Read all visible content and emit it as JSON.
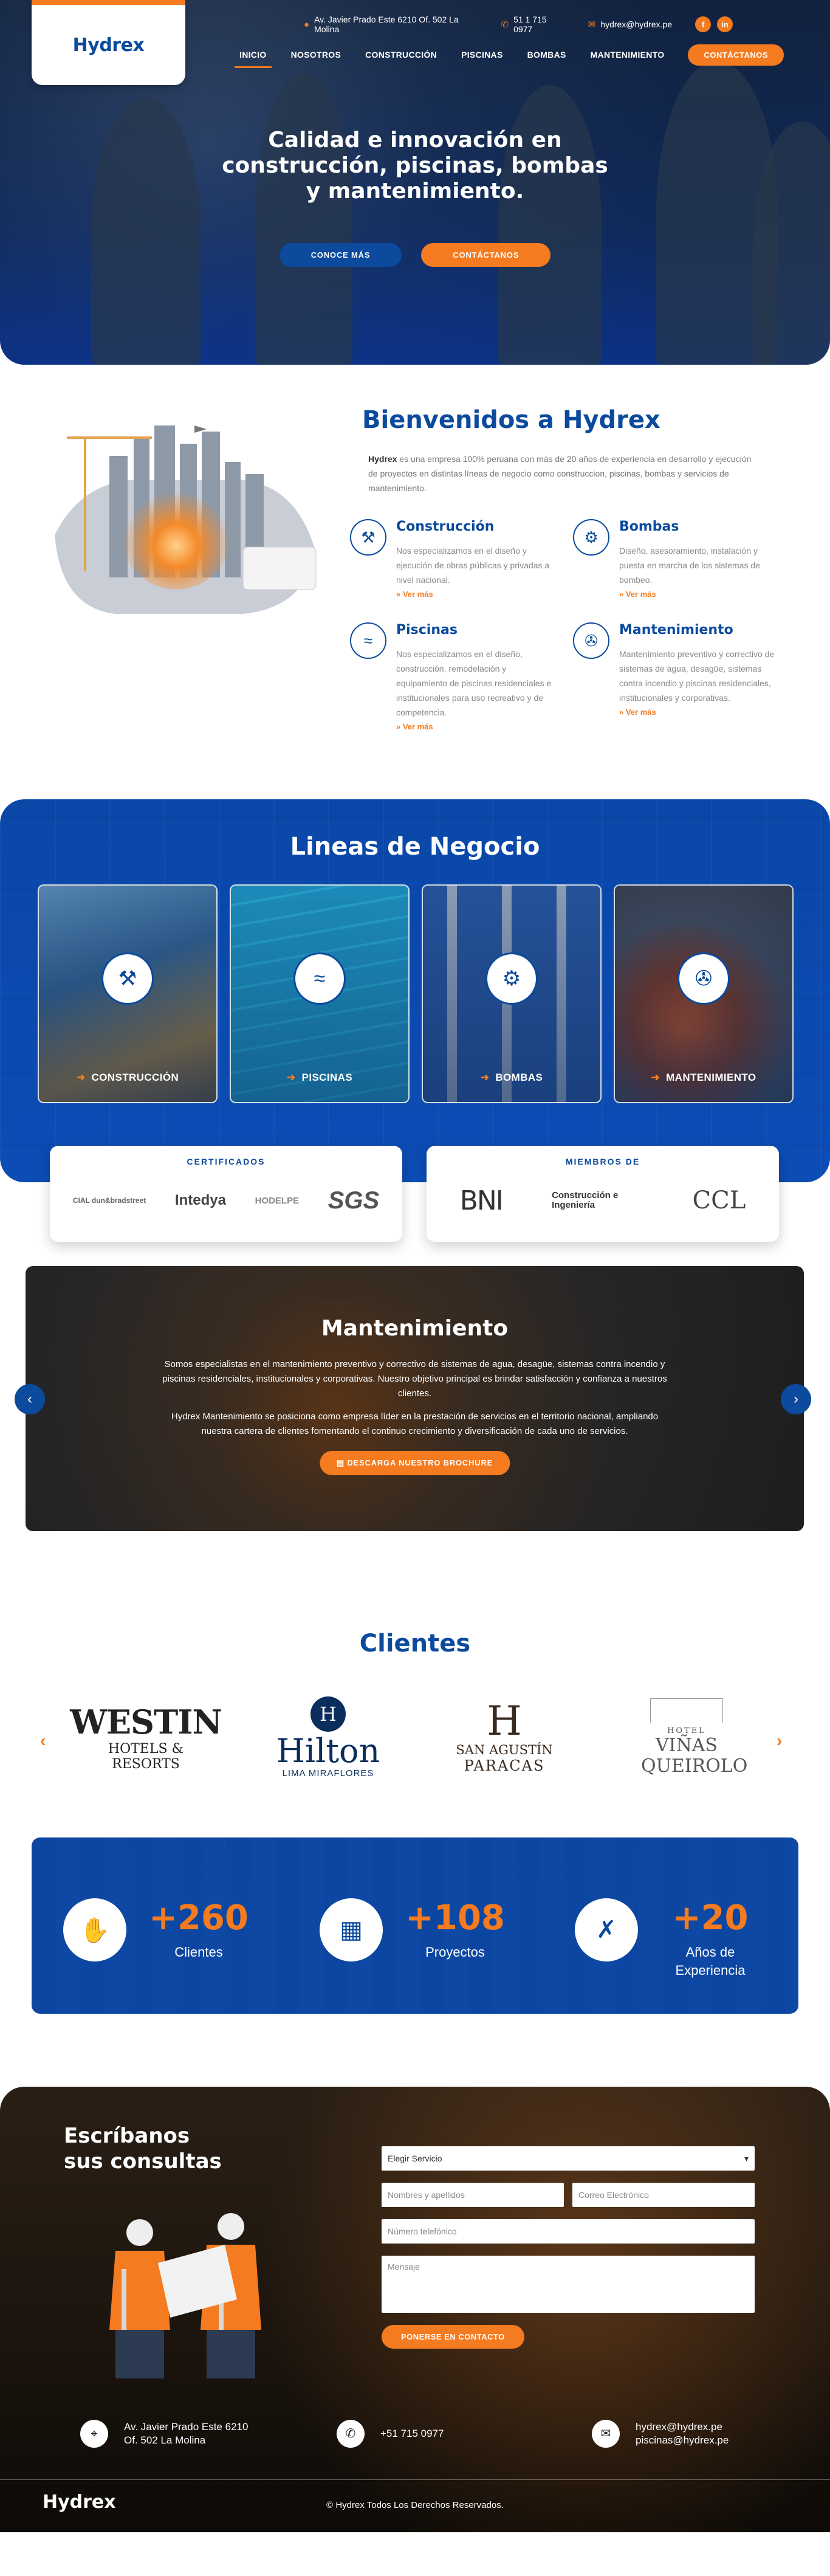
{
  "brand": {
    "logo": "Hydrex",
    "accent": "#f47b20",
    "primary": "#0b4a9c"
  },
  "topbar": {
    "address": "Av. Javier Prado Este 6210 Of. 502 La Molina",
    "phone": "51 1 715 0977",
    "email": "hydrex@hydrex.pe",
    "socials": [
      "f",
      "in"
    ]
  },
  "nav": {
    "items": [
      "INICIO",
      "NOSOTROS",
      "CONSTRUCCIÓN",
      "PISCINAS",
      "BOMBAS",
      "MANTENIMIENTO"
    ],
    "cta": "CONTÁCTANOS"
  },
  "hero": {
    "title": "Calidad e innovación en construcción, piscinas, bombas y mantenimiento.",
    "btn_primary": "CONOCE MÁS",
    "btn_secondary": "CONTÁCTANOS"
  },
  "welcome": {
    "title": "Bienvenidos a Hydrex",
    "brand_word": "Hydrex",
    "desc": " es una empresa 100% peruana con más de 20 años de experiencia en desarrollo y ejecución de proyectos en distintas líneas de negocio como construccion, piscinas, bombas y servicios de mantenimiento.",
    "services": [
      {
        "title": "Construcción",
        "icon": "construction-icon",
        "text": "Nos especializamos en el diseño y ejecución de obras públicas y privadas a nivel nacional.",
        "more": "» Ver más"
      },
      {
        "title": "Bombas",
        "icon": "pump-icon",
        "text": "Diseño, asesoramiento, instalación y puesta en marcha de los sistemas de bombeo.",
        "more": "» Ver más"
      },
      {
        "title": "Piscinas",
        "icon": "pool-icon",
        "text": "Nos especializamos en el diseño, construcción, remodelación y equipamiento de piscinas residenciales e institucionales para uso recreativo y de competencia.",
        "more": "» Ver más"
      },
      {
        "title": "Mantenimiento",
        "icon": "maintenance-icon",
        "text": "Mantenimiento preventivo y correctivo de sistemas de agua, desagüe, sistemas contra incendio y piscinas residenciales, institucionales y corporativas.",
        "more": "» Ver más"
      }
    ]
  },
  "lineas": {
    "title": "Lineas de Negocio",
    "cards": [
      {
        "label": "CONSTRUCCIÓN",
        "icon": "construction-icon"
      },
      {
        "label": "PISCINAS",
        "icon": "pool-icon"
      },
      {
        "label": "BOMBAS",
        "icon": "pump-icon"
      },
      {
        "label": "MANTENIMIENTO",
        "icon": "maintenance-icon"
      }
    ],
    "certificados": {
      "title": "CERTIFICADOS",
      "logos": [
        "CIAL dun&bradstreet",
        "Intedya",
        "HODELPE",
        "SGS"
      ]
    },
    "miembros": {
      "title": "MIEMBROS DE",
      "logos": [
        "BNI",
        "Construcción e Ingeniería",
        "CCL"
      ]
    }
  },
  "slider": {
    "title": "Mantenimiento",
    "p1": "Somos especialistas en el mantenimiento preventivo y correctivo de sistemas de agua, desagüe, sistemas contra incendio y piscinas residenciales, institucionales y corporativas. Nuestro objetivo principal es brindar satisfacción y confianza a nuestros clientes.",
    "p2": "Hydrex Mantenimiento se posiciona como empresa líder en la prestación de servicios en el territorio nacional, ampliando nuestra cartera de clientes fomentando el continuo crecimiento y diversificación de cada uno de servicios.",
    "btn": "DESCARGA NUESTRO BROCHURE",
    "prev": "‹",
    "next": "›"
  },
  "clientes": {
    "title": "Clientes",
    "logos": [
      {
        "l1": "WESTIN",
        "l2": "HOTELS & RESORTS"
      },
      {
        "l1": "Hilton",
        "l2": "LIMA MIRAFLORES"
      },
      {
        "l1": "SAN AGUSTÍN",
        "l2": "PARACAS"
      },
      {
        "l1": "HOTEL",
        "l2": "VIÑAS QUEIROLO"
      }
    ],
    "prev": "‹",
    "next": "›"
  },
  "stats": [
    {
      "num": "+260",
      "label": "Clientes",
      "icon": "handshake-icon"
    },
    {
      "num": "+108",
      "label": "Proyectos",
      "icon": "blueprint-icon"
    },
    {
      "num": "+20",
      "label": "Años de Experiencia",
      "icon": "tools-icon"
    }
  ],
  "contact": {
    "title_l1": "Escríbanos",
    "title_l2": "sus consultas",
    "service_select": "Elegir Servicio",
    "name_ph": "Nombres y apellidos",
    "email_ph": "Correo Electrónico",
    "phone_ph": "Número telefónico",
    "message_ph": "Mensaje",
    "submit": "PONERSE EN CONTACTO",
    "addr_l1": "Av. Javier Prado Este 6210",
    "addr_l2": "Of. 502 La Molina",
    "phone": "+51 715 0977",
    "email1": "hydrex@hydrex.pe",
    "email2": "piscinas@hydrex.pe"
  },
  "footer": {
    "logo": "Hydrex",
    "copyright": "© Hydrex Todos Los Derechos Reservados."
  }
}
